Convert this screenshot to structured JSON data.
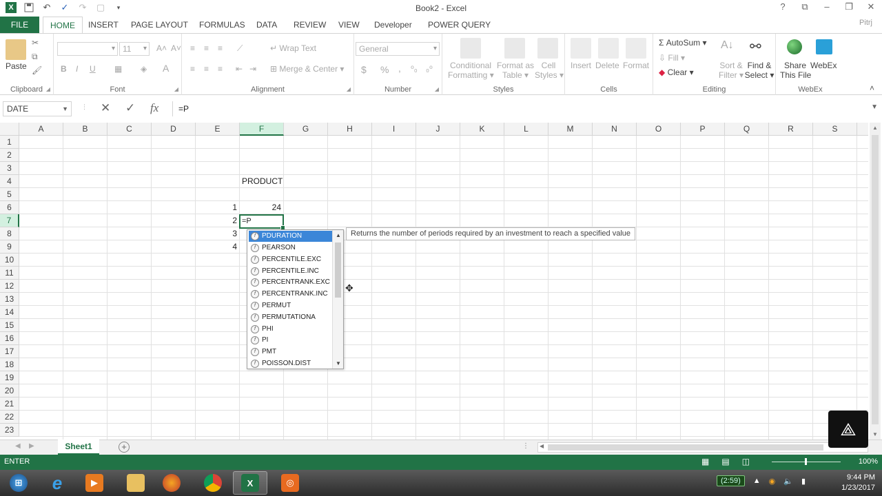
{
  "window": {
    "title": "Book2 - Excel",
    "user_label": "Pitrj"
  },
  "ribbon_tabs": [
    "FILE",
    "HOME",
    "INSERT",
    "PAGE LAYOUT",
    "FORMULAS",
    "DATA",
    "REVIEW",
    "VIEW",
    "Developer",
    "POWER QUERY"
  ],
  "ribbon": {
    "clipboard": {
      "label": "Clipboard",
      "paste": "Paste"
    },
    "font": {
      "label": "Font",
      "size": "11",
      "bold": "B",
      "italic": "I",
      "underline": "U",
      "color": "A"
    },
    "alignment": {
      "label": "Alignment",
      "wrap": "Wrap Text",
      "merge": "Merge & Center"
    },
    "number": {
      "label": "Number",
      "format": "General",
      "currency": "$",
      "percent": "%",
      "comma": ","
    },
    "styles": {
      "label": "Styles",
      "conditional": "Conditional",
      "conditional2": "Formatting",
      "format_table": "Format as",
      "format_table2": "Table",
      "cell_styles": "Cell",
      "cell_styles2": "Styles"
    },
    "cells": {
      "label": "Cells",
      "insert": "Insert",
      "delete": "Delete",
      "format": "Format"
    },
    "editing": {
      "label": "Editing",
      "autosum": "AutoSum",
      "fill": "Fill",
      "clear": "Clear",
      "sort": "Sort &",
      "sort2": "Filter",
      "find": "Find &",
      "find2": "Select"
    },
    "webex": {
      "label": "WebEx",
      "share": "Share",
      "share2": "This File",
      "webex": "WebEx"
    }
  },
  "formula_bar": {
    "name_box": "DATE",
    "cancel": "✕",
    "enter": "✓",
    "fx": "fx",
    "content": "=P"
  },
  "columns": [
    "A",
    "B",
    "C",
    "D",
    "E",
    "F",
    "G",
    "H",
    "I",
    "J",
    "K",
    "L",
    "M",
    "N",
    "O",
    "P",
    "Q",
    "R",
    "S"
  ],
  "rows": [
    "1",
    "2",
    "3",
    "4",
    "5",
    "6",
    "7",
    "8",
    "9",
    "10",
    "11",
    "12",
    "13",
    "14",
    "15",
    "16",
    "17",
    "18",
    "19",
    "20",
    "21",
    "22",
    "23"
  ],
  "cells": {
    "F4": "PRODUCT",
    "E6": "1",
    "F6": "24",
    "E7": "2",
    "F7": "=P",
    "E8": "3",
    "E9": "4"
  },
  "autocomplete": {
    "items": [
      "PDURATION",
      "PEARSON",
      "PERCENTILE.EXC",
      "PERCENTILE.INC",
      "PERCENTRANK.EXC",
      "PERCENTRANK.INC",
      "PERMUT",
      "PERMUTATIONA",
      "PHI",
      "PI",
      "PMT",
      "POISSON.DIST"
    ],
    "selected": "PDURATION",
    "tooltip": "Returns the number of periods required by an investment to reach a specified value"
  },
  "sheets": {
    "active": "Sheet1"
  },
  "status": {
    "mode": "ENTER",
    "zoom": "100%"
  },
  "taskbar": {
    "battery": "(2:59)",
    "time": "9:44 PM",
    "date": "1/23/2017"
  },
  "colors": {
    "excel_green": "#217346",
    "selection_blue": "#3b86d8"
  }
}
